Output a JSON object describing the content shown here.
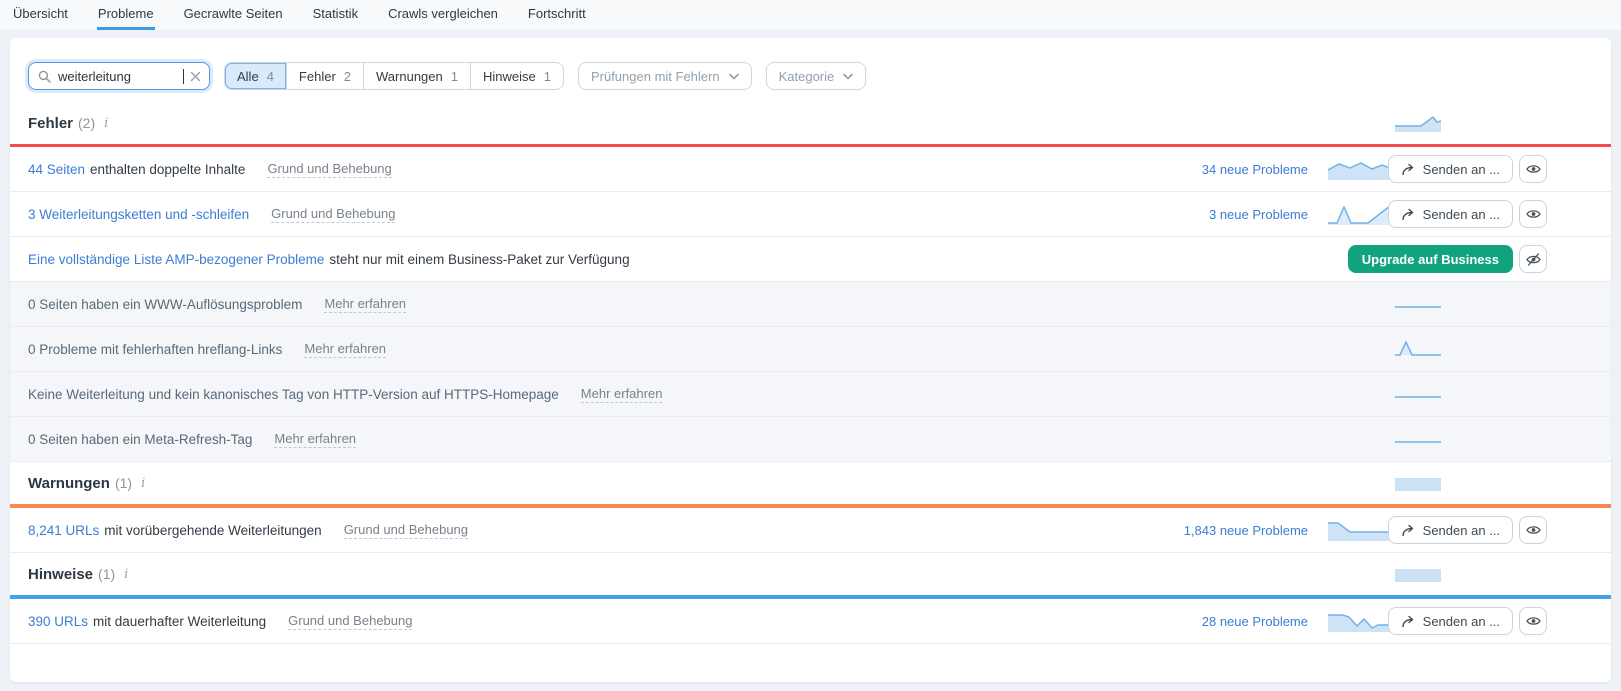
{
  "nav": {
    "tabs": [
      {
        "label": "Übersicht",
        "active": false
      },
      {
        "label": "Probleme",
        "active": true
      },
      {
        "label": "Gecrawlte Seiten",
        "active": false
      },
      {
        "label": "Statistik",
        "active": false
      },
      {
        "label": "Crawls vergleichen",
        "active": false
      },
      {
        "label": "Fortschritt",
        "active": false
      }
    ]
  },
  "toolbar": {
    "search": {
      "value": "weiterleitung",
      "clear_icon": "x"
    },
    "segments": [
      {
        "label": "Alle",
        "count": "4",
        "selected": true
      },
      {
        "label": "Fehler",
        "count": "2",
        "selected": false
      },
      {
        "label": "Warnungen",
        "count": "1",
        "selected": false
      },
      {
        "label": "Hinweise",
        "count": "1",
        "selected": false
      }
    ],
    "filters": [
      {
        "label": "Prüfungen mit Fehlern"
      },
      {
        "label": "Kategorie"
      }
    ]
  },
  "glyphs": {
    "info": "i"
  },
  "buttons": {
    "send": "Senden an ...",
    "upgrade": "Upgrade auf Business"
  },
  "sections": [
    {
      "title": "Fehler",
      "count": "(2)",
      "rows": [
        {
          "link": "44 Seiten",
          "text": "enthalten doppelte Inhalte",
          "help": "Grund und Behebung",
          "new_problems": "34 neue Probleme"
        },
        {
          "link": "3 Weiterleitungsketten und -schleifen",
          "text": "",
          "help": "Grund und Behebung",
          "new_problems": "3 neue Probleme"
        },
        {
          "link": "Eine vollständige Liste AMP-bezogener Probleme",
          "text": "steht nur mit einem Business-Paket zur Verfügung"
        },
        {
          "text": "0 Seiten haben ein WWW-Auflösungsproblem",
          "help": "Mehr erfahren"
        },
        {
          "text": "0 Probleme mit fehlerhaften hreflang-Links",
          "help": "Mehr erfahren"
        },
        {
          "text": "Keine Weiterleitung und kein kanonisches Tag von HTTP-Version auf HTTPS-Homepage",
          "help": "Mehr erfahren"
        },
        {
          "text": "0 Seiten haben ein Meta-Refresh-Tag",
          "help": "Mehr erfahren"
        }
      ]
    },
    {
      "title": "Warnungen",
      "count": "(1)",
      "rows": [
        {
          "link": "8,241 URLs",
          "text": "mit vorübergehende Weiterleitungen",
          "help": "Grund und Behebung",
          "new_problems": "1,843 neue Probleme"
        }
      ]
    },
    {
      "title": "Hinweise",
      "count": "(1)",
      "rows": [
        {
          "link": "390 URLs",
          "text": "mit dauerhafter Weiterleitung",
          "help": "Grund und Behebung",
          "new_problems": "28 neue Probleme"
        }
      ]
    }
  ],
  "colors": {
    "error_line": "#f24a4e",
    "warning_line": "#f78b4e",
    "notice_line": "#41a3e8",
    "link_blue": "#3c7dd3",
    "upgrade_green": "#11a37e",
    "spark_line": "#74b0e8",
    "spark_fill": "#cfe3f7",
    "active_tab_underline": "#3f9ae5"
  }
}
